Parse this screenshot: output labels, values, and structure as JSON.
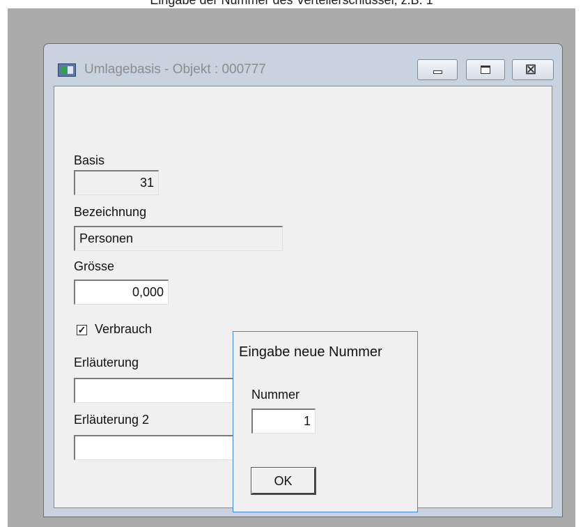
{
  "caption": "Eingabe der Nummer des Verteilerschlüssel, z.B. 1",
  "window": {
    "title": "Umlagebasis - Objekt : 000777"
  },
  "form": {
    "basis": {
      "label": "Basis",
      "value": "31"
    },
    "bezeichnung": {
      "label": "Bezeichnung",
      "value": "Personen"
    },
    "groesse": {
      "label": "Grösse",
      "value": "0,000"
    },
    "verbrauch": {
      "label": "Verbrauch",
      "checked": true
    },
    "erlaeuterung": {
      "label": "Erläuterung",
      "value": ""
    },
    "erlaeuterung2": {
      "label": "Erläuterung 2",
      "value": ""
    }
  },
  "dialog": {
    "title": "Eingabe neue Nummer",
    "nummer_label": "Nummer",
    "nummer_value": "1",
    "ok_label": "OK"
  },
  "icons": {
    "app": "window-app-icon",
    "minimize": "minimize-icon",
    "maximize": "maximize-icon",
    "close": "close-icon",
    "check": "checkmark-icon"
  }
}
